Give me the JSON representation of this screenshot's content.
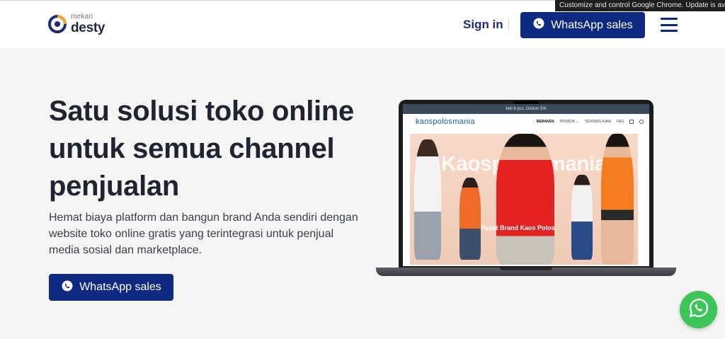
{
  "browser": {
    "automation_banner": "Customize and control Google Chrome. Update is available"
  },
  "header": {
    "logo_small": "mekari",
    "logo_big": "desty",
    "signin_label": "Sign in",
    "whatsapp_label": "WhatsApp sales"
  },
  "hero": {
    "title": "Satu solusi toko online untuk semua channel penjualan",
    "description": "Hemat biaya platform dan bangun brand Anda sendiri dengan website toko online gratis yang terintegrasi untuk penjual media sosial dan marketplace.",
    "whatsapp_label": "WhatsApp sales"
  },
  "preview_site": {
    "promo": "beli 6 pcs. Diskon 5%",
    "logo": "kaospolosmania",
    "nav": [
      "BERANDA",
      "PRODUK ⌄",
      "TENTANG KAMI",
      "FAQ"
    ],
    "banner_title": "Kaospolosmania",
    "banner_subtitle": "Pusat Brand Kaos Polos"
  },
  "colors": {
    "primary": "#0e2a80",
    "whatsapp_green": "#3ec55a",
    "background": "#f6f5f4"
  },
  "icons": {
    "whatsapp": "whatsapp-icon",
    "menu": "hamburger-menu-icon"
  }
}
